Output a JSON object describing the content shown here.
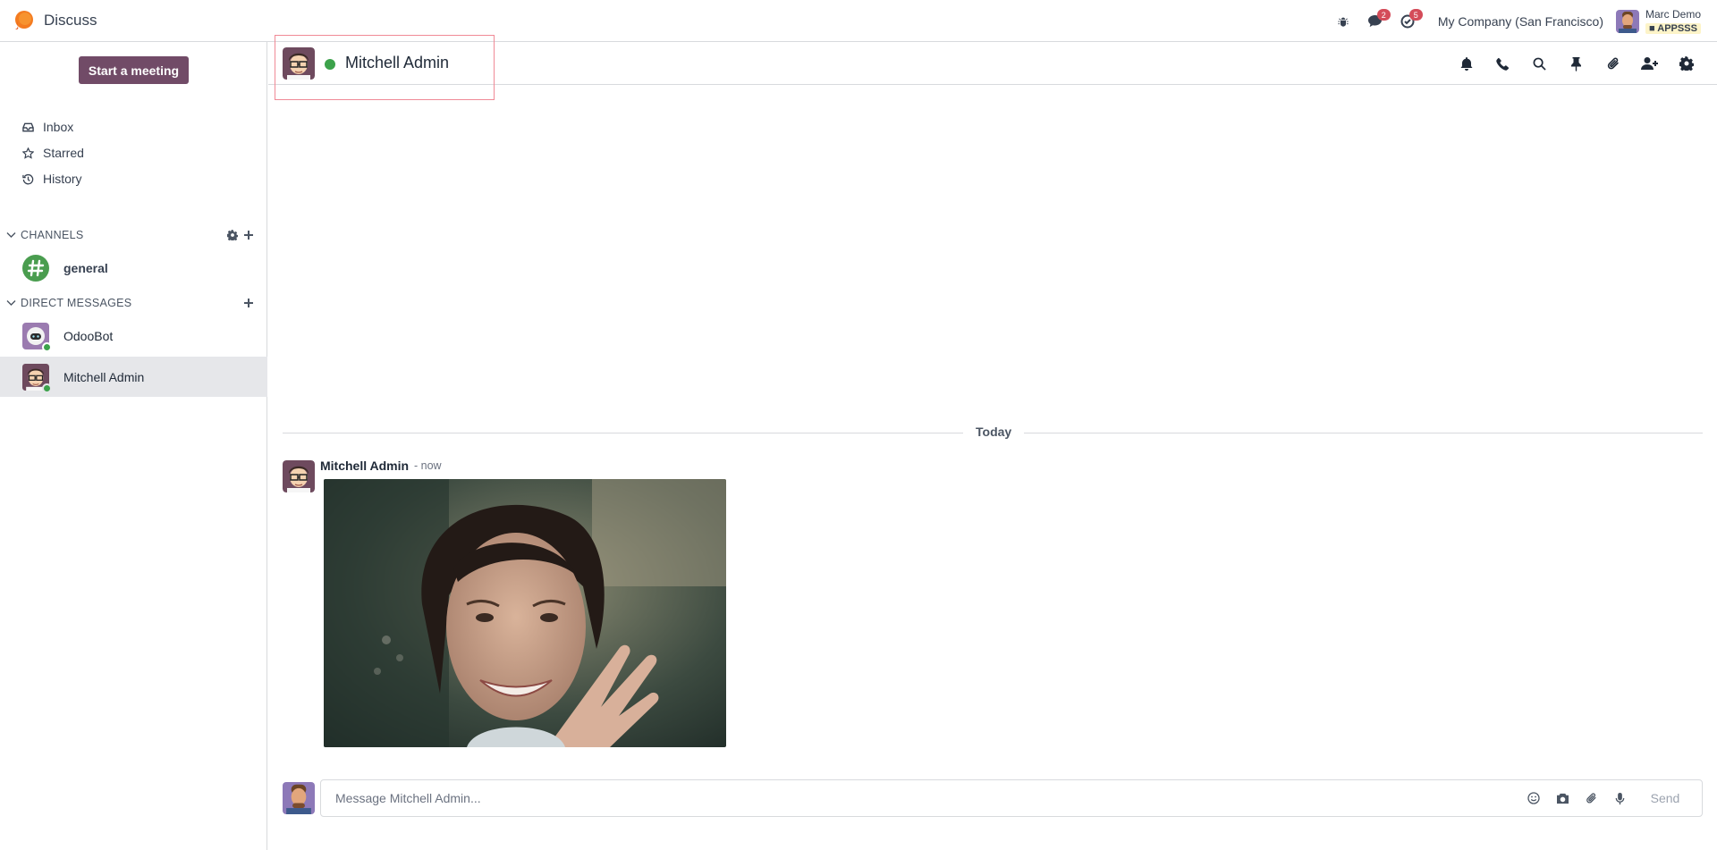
{
  "navbar": {
    "app_name": "Discuss",
    "messages_badge": "2",
    "activities_badge": "5",
    "company": "My Company (San Francisco)",
    "user_name": "Marc Demo",
    "user_db": "APPSSS"
  },
  "sidebar": {
    "start_meeting": "Start a meeting",
    "mailboxes": [
      {
        "label": "Inbox",
        "icon": "inbox-icon"
      },
      {
        "label": "Starred",
        "icon": "star-icon"
      },
      {
        "label": "History",
        "icon": "history-icon"
      }
    ],
    "channels_header": "CHANNELS",
    "channels": [
      {
        "name": "general"
      }
    ],
    "dm_header": "DIRECT MESSAGES",
    "direct_messages": [
      {
        "name": "OdooBot"
      },
      {
        "name": "Mitchell Admin"
      }
    ]
  },
  "thread": {
    "name": "Mitchell Admin",
    "actions": [
      "bell-icon",
      "phone-icon",
      "search-icon",
      "pin-icon",
      "paperclip-icon",
      "add-user-icon",
      "gear-icon"
    ]
  },
  "messages": {
    "date_separator": "Today",
    "items": [
      {
        "author": "Mitchell Admin",
        "date": "- now"
      }
    ]
  },
  "composer": {
    "placeholder": "Message Mitchell Admin...",
    "send_label": "Send"
  },
  "colors": {
    "brand": "#714b67",
    "online": "#3ca24b",
    "badge": "#d44c59",
    "focus_outline": "#f08a96"
  }
}
